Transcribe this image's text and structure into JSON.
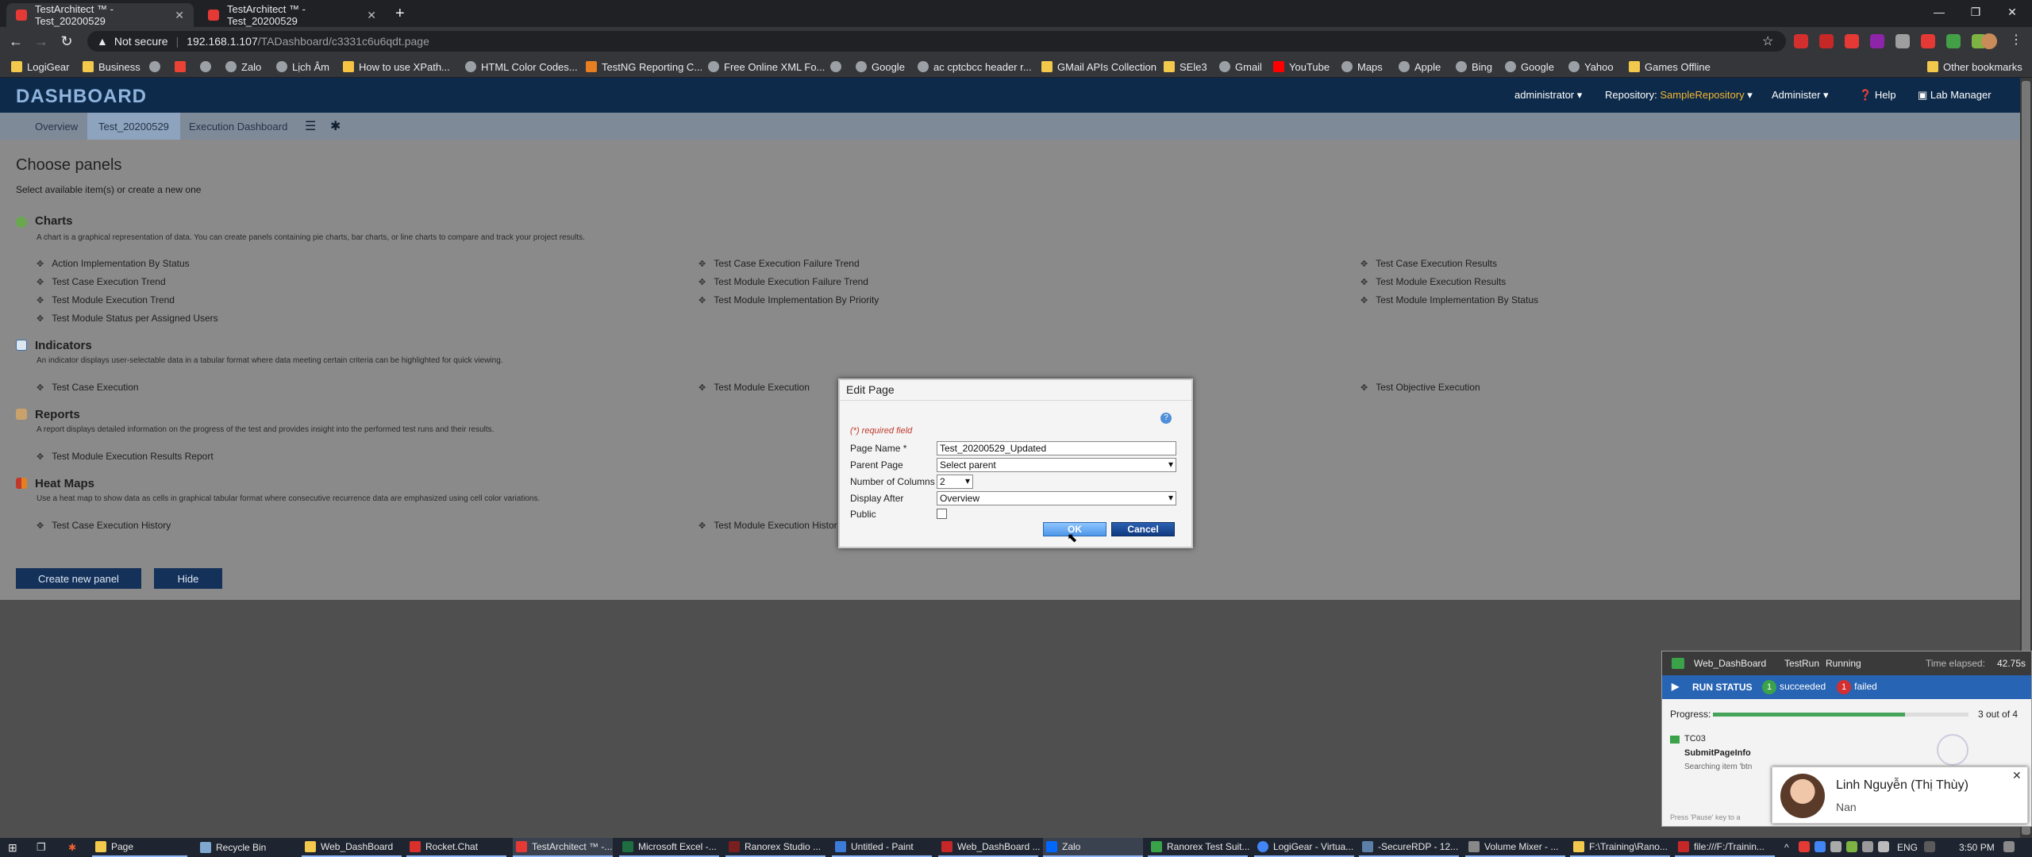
{
  "browser": {
    "tabs": [
      {
        "title": "TestArchitect ™ - Test_20200529"
      },
      {
        "title": "TestArchitect ™ - Test_20200529"
      }
    ],
    "address": {
      "security": "Not secure",
      "host": "192.168.1.107",
      "path": "/TADashboard/c3331c6u6qdt.page"
    },
    "bookmarks": [
      {
        "label": "LogiGear",
        "icon": "folder-icon"
      },
      {
        "label": "Business",
        "icon": "folder-icon"
      },
      {
        "label": "",
        "icon": "globe-icon"
      },
      {
        "label": "",
        "icon": "gmail-icon"
      },
      {
        "label": "",
        "icon": "globe-icon"
      },
      {
        "label": "Zalo",
        "icon": "globe-icon"
      },
      {
        "label": "Lịch Âm",
        "icon": "globe-icon"
      },
      {
        "label": "How to use XPath...",
        "icon": "bookmark-icon"
      },
      {
        "label": "HTML Color Codes...",
        "icon": "globe-icon"
      },
      {
        "label": "TestNG Reporting C...",
        "icon": "bookmark-icon"
      },
      {
        "label": "Free Online XML Fo...",
        "icon": "globe-icon"
      },
      {
        "label": "",
        "icon": "globe-icon"
      },
      {
        "label": "Google",
        "icon": "globe-icon"
      },
      {
        "label": "ac cptcbcc header r...",
        "icon": "globe-icon"
      },
      {
        "label": "GMail APIs Collection",
        "icon": "folder-icon"
      },
      {
        "label": "SEle3",
        "icon": "folder-icon"
      },
      {
        "label": "Gmail",
        "icon": "globe-icon"
      },
      {
        "label": "YouTube",
        "icon": "youtube-icon"
      },
      {
        "label": "Maps",
        "icon": "globe-icon"
      },
      {
        "label": "Apple",
        "icon": "globe-icon"
      },
      {
        "label": "Bing",
        "icon": "globe-icon"
      },
      {
        "label": "Google",
        "icon": "globe-icon"
      },
      {
        "label": "Yahoo",
        "icon": "globe-icon"
      },
      {
        "label": "Games Offline",
        "icon": "folder-icon"
      }
    ],
    "other_bookmarks": "Other bookmarks"
  },
  "dashboard": {
    "logo": "DASHBOARD",
    "menu": {
      "user": "administrator",
      "repository_label": "Repository:",
      "repository_value": "SampleRepository",
      "administer": "Administer",
      "help": "Help",
      "lab_manager": "Lab Manager"
    },
    "tabs": [
      "Overview",
      "Test_20200529",
      "Execution Dashboard"
    ],
    "title": "Choose panels",
    "subtitle": "Select available item(s) or create a new one",
    "sections": {
      "charts": {
        "title": "Charts",
        "desc": "A chart is a graphical representation of data. You can create panels containing pie charts, bar charts, or line charts to compare and track your project results.",
        "items": [
          "Action Implementation By Status",
          "Test Case Execution Failure Trend",
          "Test Case Execution Results",
          "Test Case Execution Trend",
          "Test Module Execution Failure Trend",
          "Test Module Execution Results",
          "Test Module Execution Trend",
          "Test Module Implementation By Priority",
          "Test Module Implementation By Status",
          "Test Module Status per Assigned Users"
        ]
      },
      "indicators": {
        "title": "Indicators",
        "desc": "An indicator displays user-selectable data in a tabular format where data meeting certain criteria can be highlighted for quick viewing.",
        "items": [
          "Test Case Execution",
          "Test Module Execution",
          "Test Objective Execution"
        ]
      },
      "reports": {
        "title": "Reports",
        "desc": "A report displays detailed information on the progress of the test and provides insight into the performed test runs and their results.",
        "items": [
          "Test Module Execution Results Report"
        ]
      },
      "heatmaps": {
        "title": "Heat Maps",
        "desc": "Use a heat map to show data as cells in graphical tabular format where consecutive recurrence data are emphasized using cell color variations.",
        "items": [
          "Test Case Execution History",
          "Test Module Execution Histor"
        ]
      }
    },
    "buttons": {
      "create": "Create new panel",
      "hide": "Hide"
    }
  },
  "dialog": {
    "title": "Edit Page",
    "required_note": "(*) required field",
    "page_name_label": "Page Name *",
    "page_name_value": "Test_20200529_Updated",
    "parent_label": "Parent Page",
    "parent_value": "Select parent",
    "columns_label": "Number of Columns",
    "columns_value": "2",
    "display_after_label": "Display After",
    "display_after_value": "Overview",
    "public_label": "Public",
    "ok": "OK",
    "cancel": "Cancel"
  },
  "run_panel": {
    "project": "Web_DashBoard",
    "testrun": "TestRun",
    "state": "Running",
    "elapsed_label": "Time elapsed:",
    "elapsed_value": "42.75s",
    "status_label": "RUN STATUS",
    "succeeded_count": "1",
    "succeeded_label": "succeeded",
    "failed_count": "1",
    "failed_label": "failed",
    "progress_label": "Progress:",
    "progress_text": "3 out of 4",
    "progress_fraction": 0.75,
    "testcase": "TC03",
    "action": "SubmitPageInfo",
    "searching": "Searching item 'btn",
    "pause_hint": "Press 'Pause' key to a"
  },
  "notification": {
    "name": "Linh Nguyễn (Thị Thùy)",
    "message": "Nan"
  },
  "taskbar": {
    "items": [
      "Page",
      "Recycle Bin",
      "Web_DashBoard",
      "Rocket.Chat",
      "TestArchitect ™ -...",
      "Microsoft Excel -...",
      "Ranorex Studio ...",
      "Untitled - Paint",
      "Web_DashBoard ...",
      "Zalo",
      "Ranorex Test Suit...",
      "LogiGear - Virtua...",
      "-SecureRDP - 12...",
      "Volume Mixer - ...",
      "F:\\Training\\Rano...",
      "file:///F:/Trainin..."
    ],
    "lang": "ENG",
    "time": "3:50 PM"
  }
}
